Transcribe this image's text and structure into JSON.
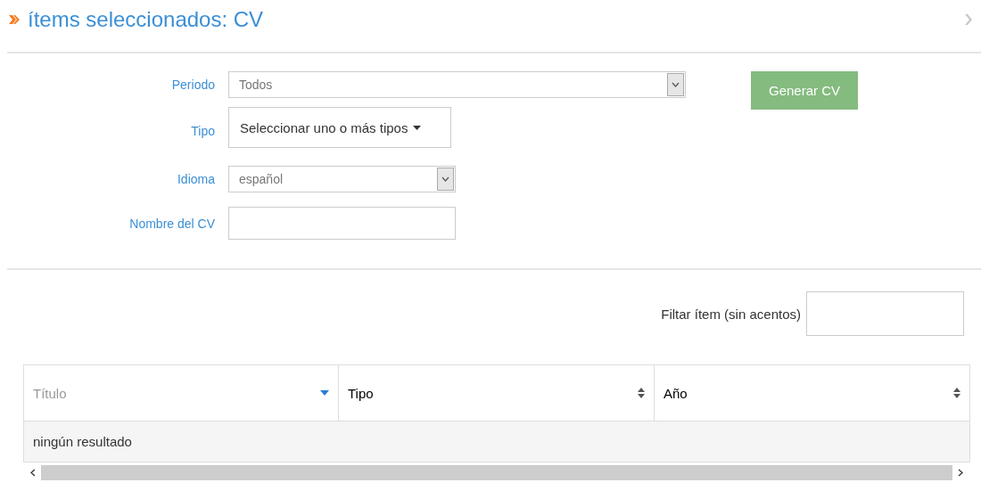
{
  "header": {
    "title": "ítems seleccionados: CV"
  },
  "form": {
    "fields": [
      {
        "kind": "long_select",
        "label": "Periodo",
        "value": "Todos"
      },
      {
        "kind": "multiselect",
        "label": "Tipo",
        "value": "Seleccionar uno o más tipos"
      },
      {
        "kind": "select",
        "label": "Idioma",
        "value": "español"
      },
      {
        "kind": "text",
        "label": "Nombre del CV"
      }
    ],
    "submit": "Generar CV"
  },
  "filter": {
    "label": "Filtar ítem (sin acentos)"
  },
  "table": {
    "columns": [
      {
        "label": "Título",
        "sorted": true
      },
      {
        "label": "Tipo",
        "sorted": false
      },
      {
        "label": "Año",
        "sorted": false
      }
    ],
    "empty_message": "ningún resultado"
  }
}
